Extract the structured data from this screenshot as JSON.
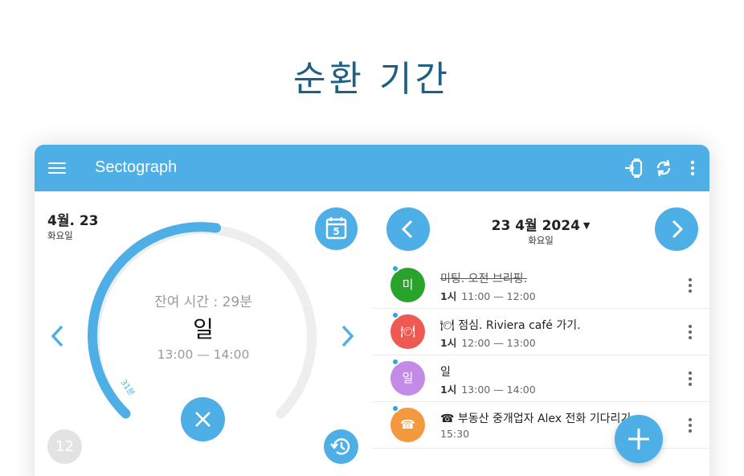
{
  "headline": "순환 기간",
  "appbar": {
    "title": "Sectograph",
    "menu_icon": "menu-icon",
    "watch_icon": "watch-sync-icon",
    "sync_icon": "sync-icon",
    "more_icon": "more-vert-icon"
  },
  "left": {
    "date": "4월. 23",
    "weekday": "화요일",
    "calendar_day": "5",
    "remaining": "잔여 시간 : 29분",
    "task_name": "일",
    "task_time": "13:00 — 14:00",
    "elapsed_label": "31분",
    "hour": "12"
  },
  "right": {
    "date": "23 4월 2024",
    "weekday": "화요일",
    "tasks": [
      {
        "avatar": "미",
        "color": "#2aa32c",
        "name": "미팅. 오전 브리핑.",
        "done": true,
        "duration": "1시",
        "time": "11:00 — 12:00"
      },
      {
        "avatar": "🍽",
        "color": "#ee5a52",
        "name": "🍽 점심. Riviera café 가기.",
        "done": false,
        "duration": "1시",
        "time": "12:00 — 13:00"
      },
      {
        "avatar": "일",
        "color": "#c48be6",
        "name": "일",
        "done": false,
        "duration": "1시",
        "time": "13:00 — 14:00"
      },
      {
        "avatar": "☎",
        "color": "#f49a3e",
        "name": "☎ 부동산 중개업자 Alex 전화 기다리기",
        "done": false,
        "duration": "",
        "time": "15:30"
      }
    ]
  },
  "colors": {
    "accent": "#4eaee6",
    "headline": "#1e5f86",
    "track": "#eeeeee"
  }
}
